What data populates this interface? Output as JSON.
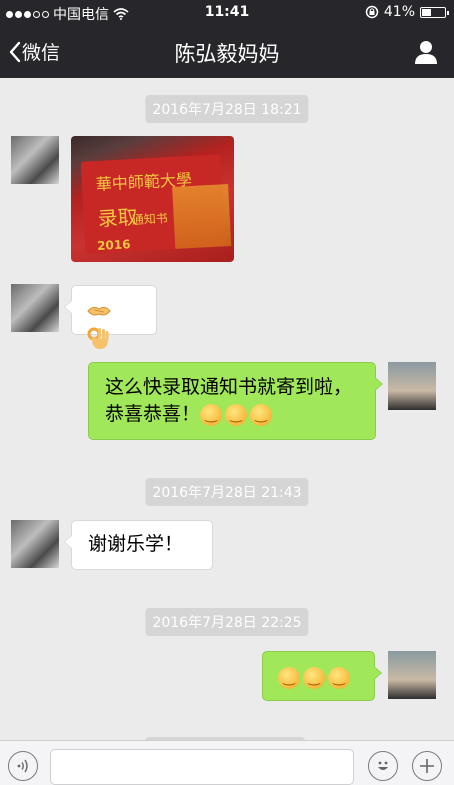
{
  "status_bar": {
    "carrier": "中国电信",
    "time": "11:41",
    "battery_percent": "41%",
    "battery_level": 0.41,
    "signal_bars_filled": 3,
    "signal_bars_total": 5
  },
  "nav_bar": {
    "back_label": "微信",
    "title": "陈弘毅妈妈",
    "icons": {
      "back": "chevron-left-icon",
      "profile": "person-icon"
    }
  },
  "messages": [
    {
      "type": "timestamp",
      "text": "2016年7月28日 18:21"
    },
    {
      "type": "image",
      "sender": "mom",
      "image_text": {
        "logo": "華中師範大學",
        "big": "录取",
        "small": "通知书",
        "year": "2016"
      }
    },
    {
      "type": "emoji",
      "sender": "mom",
      "emojis": [
        "handshake-emoji",
        "ok-hand-emoji"
      ]
    },
    {
      "type": "text",
      "sender": "me",
      "text": "这么快录取通知书就寄到啦，恭喜恭喜！",
      "emojis": [
        "smile-emoji",
        "smile-emoji",
        "smile-emoji"
      ]
    },
    {
      "type": "timestamp",
      "text": "2016年7月28日 21:43"
    },
    {
      "type": "text",
      "sender": "mom",
      "text": "谢谢乐学！"
    },
    {
      "type": "timestamp",
      "text": "2016年7月28日 22:25"
    },
    {
      "type": "emoji",
      "sender": "me",
      "emojis": [
        "smile-emoji",
        "smile-emoji",
        "smile-emoji"
      ]
    }
  ],
  "input_bar": {
    "icons": {
      "voice": "voice-icon",
      "emoji": "emoji-face-icon",
      "plus": "plus-icon"
    },
    "input_value": ""
  },
  "colors": {
    "nav_background": "#27272b",
    "chat_background": "#ebebeb",
    "sent_bubble": "#a0e759",
    "received_bubble": "#ffffff",
    "timestamp_background": "#d5d5d5"
  }
}
